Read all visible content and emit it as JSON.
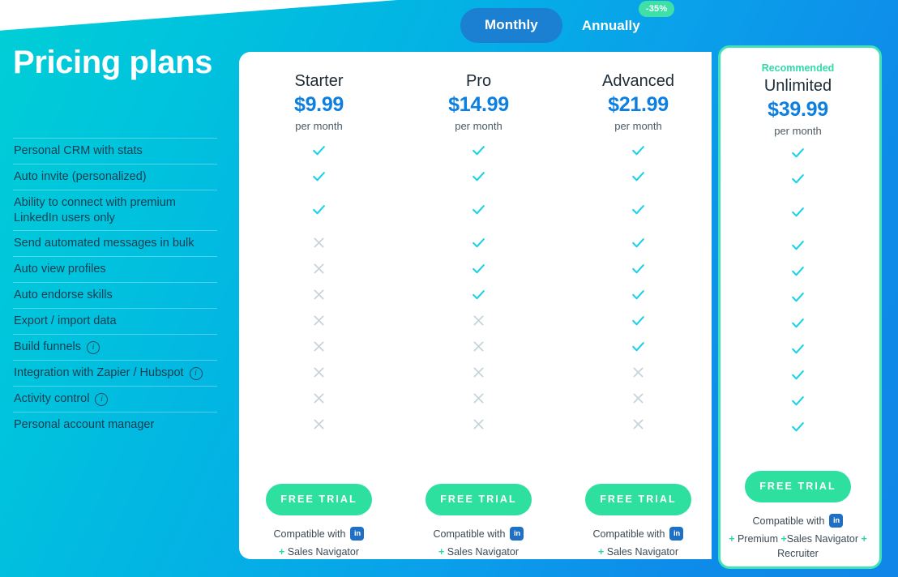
{
  "page": {
    "title": "Pricing plans"
  },
  "billing_toggle": {
    "monthly_label": "Monthly",
    "annually_label": "Annually",
    "discount_badge": "-35%",
    "selected": "Monthly"
  },
  "features": [
    {
      "label": "Personal CRM with stats",
      "info": false
    },
    {
      "label": "Auto invite (personalized)",
      "info": false
    },
    {
      "label": "Ability to connect with premium LinkedIn users only",
      "info": false
    },
    {
      "label": "Send automated messages in bulk",
      "info": false
    },
    {
      "label": "Auto view profiles",
      "info": false
    },
    {
      "label": "Auto endorse skills",
      "info": false
    },
    {
      "label": "Export / import data",
      "info": false
    },
    {
      "label": "Build funnels",
      "info": true
    },
    {
      "label": "Integration with Zapier / Hubspot",
      "info": true
    },
    {
      "label": "Activity control",
      "info": true
    },
    {
      "label": "Personal account manager",
      "info": false
    }
  ],
  "plans": [
    {
      "name": "Starter",
      "price": "$9.99",
      "period": "per month",
      "recommended_label": "",
      "recommended": false,
      "cta": "FREE TRIAL",
      "compatible_label": "Compatible with",
      "compatible_icon": "linkedin-icon",
      "addons": "+ Sales Navigator",
      "marks": [
        "check",
        "check",
        "check",
        "cross",
        "cross",
        "cross",
        "cross",
        "cross",
        "cross",
        "cross",
        "cross"
      ]
    },
    {
      "name": "Pro",
      "price": "$14.99",
      "period": "per month",
      "recommended_label": "",
      "recommended": false,
      "cta": "FREE TRIAL",
      "compatible_label": "Compatible with",
      "compatible_icon": "linkedin-icon",
      "addons": "+ Sales Navigator",
      "marks": [
        "check",
        "check",
        "check",
        "check",
        "check",
        "check",
        "cross",
        "cross",
        "cross",
        "cross",
        "cross"
      ]
    },
    {
      "name": "Advanced",
      "price": "$21.99",
      "period": "per month",
      "recommended_label": "",
      "recommended": false,
      "cta": "FREE TRIAL",
      "compatible_label": "Compatible with",
      "compatible_icon": "linkedin-icon",
      "addons": "+ Sales Navigator",
      "marks": [
        "check",
        "check",
        "check",
        "check",
        "check",
        "check",
        "check",
        "check",
        "cross",
        "cross",
        "cross"
      ]
    },
    {
      "name": "Unlimited",
      "price": "$39.99",
      "period": "per month",
      "recommended_label": "Recommended",
      "recommended": true,
      "cta": "FREE TRIAL",
      "compatible_label": "Compatible with",
      "compatible_icon": "linkedin-icon",
      "addons": "+ Premium +Sales Navigator + Recruiter",
      "marks": [
        "check",
        "check",
        "check",
        "check",
        "check",
        "check",
        "check",
        "check",
        "check",
        "check",
        "check"
      ]
    }
  ],
  "colors": {
    "accent_mint": "#2ee0a0",
    "accent_cyan": "#1bd2e8",
    "price_blue": "#0c7fe0",
    "toggle_pill": "#1b7fd2",
    "cross_gray": "#c6d2d9",
    "linkedin_blue": "#1f6fc4"
  },
  "icons": {
    "info": "i",
    "linkedin": "in"
  }
}
